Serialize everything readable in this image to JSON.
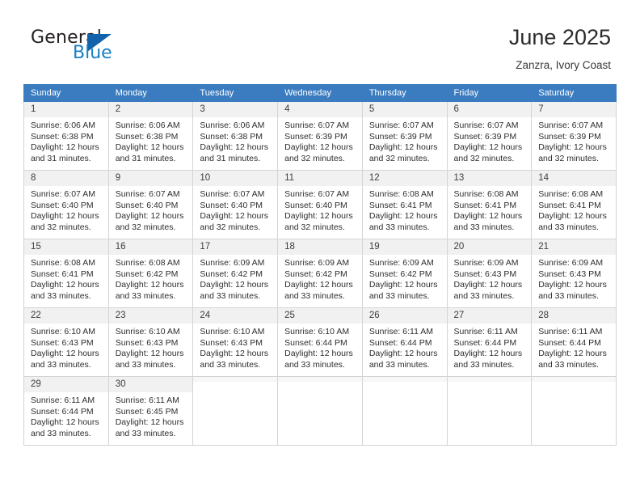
{
  "brand": {
    "name_top": "General",
    "name_bottom": "Blue",
    "accent_color": "#1161ab",
    "blue_text_color": "#1b7fc4",
    "triangle_icon": "triangle-icon"
  },
  "header": {
    "title": "June 2025",
    "subtitle": "Zanzra, Ivory Coast"
  },
  "calendar": {
    "header_color": "#3b7cc0",
    "weekday_headers": [
      "Sunday",
      "Monday",
      "Tuesday",
      "Wednesday",
      "Thursday",
      "Friday",
      "Saturday"
    ],
    "weeks": [
      [
        {
          "day": "1",
          "sunrise": "Sunrise: 6:06 AM",
          "sunset": "Sunset: 6:38 PM",
          "daylight_line1": "Daylight: 12 hours",
          "daylight_line2": "and 31 minutes."
        },
        {
          "day": "2",
          "sunrise": "Sunrise: 6:06 AM",
          "sunset": "Sunset: 6:38 PM",
          "daylight_line1": "Daylight: 12 hours",
          "daylight_line2": "and 31 minutes."
        },
        {
          "day": "3",
          "sunrise": "Sunrise: 6:06 AM",
          "sunset": "Sunset: 6:38 PM",
          "daylight_line1": "Daylight: 12 hours",
          "daylight_line2": "and 31 minutes."
        },
        {
          "day": "4",
          "sunrise": "Sunrise: 6:07 AM",
          "sunset": "Sunset: 6:39 PM",
          "daylight_line1": "Daylight: 12 hours",
          "daylight_line2": "and 32 minutes."
        },
        {
          "day": "5",
          "sunrise": "Sunrise: 6:07 AM",
          "sunset": "Sunset: 6:39 PM",
          "daylight_line1": "Daylight: 12 hours",
          "daylight_line2": "and 32 minutes."
        },
        {
          "day": "6",
          "sunrise": "Sunrise: 6:07 AM",
          "sunset": "Sunset: 6:39 PM",
          "daylight_line1": "Daylight: 12 hours",
          "daylight_line2": "and 32 minutes."
        },
        {
          "day": "7",
          "sunrise": "Sunrise: 6:07 AM",
          "sunset": "Sunset: 6:39 PM",
          "daylight_line1": "Daylight: 12 hours",
          "daylight_line2": "and 32 minutes."
        }
      ],
      [
        {
          "day": "8",
          "sunrise": "Sunrise: 6:07 AM",
          "sunset": "Sunset: 6:40 PM",
          "daylight_line1": "Daylight: 12 hours",
          "daylight_line2": "and 32 minutes."
        },
        {
          "day": "9",
          "sunrise": "Sunrise: 6:07 AM",
          "sunset": "Sunset: 6:40 PM",
          "daylight_line1": "Daylight: 12 hours",
          "daylight_line2": "and 32 minutes."
        },
        {
          "day": "10",
          "sunrise": "Sunrise: 6:07 AM",
          "sunset": "Sunset: 6:40 PM",
          "daylight_line1": "Daylight: 12 hours",
          "daylight_line2": "and 32 minutes."
        },
        {
          "day": "11",
          "sunrise": "Sunrise: 6:07 AM",
          "sunset": "Sunset: 6:40 PM",
          "daylight_line1": "Daylight: 12 hours",
          "daylight_line2": "and 32 minutes."
        },
        {
          "day": "12",
          "sunrise": "Sunrise: 6:08 AM",
          "sunset": "Sunset: 6:41 PM",
          "daylight_line1": "Daylight: 12 hours",
          "daylight_line2": "and 33 minutes."
        },
        {
          "day": "13",
          "sunrise": "Sunrise: 6:08 AM",
          "sunset": "Sunset: 6:41 PM",
          "daylight_line1": "Daylight: 12 hours",
          "daylight_line2": "and 33 minutes."
        },
        {
          "day": "14",
          "sunrise": "Sunrise: 6:08 AM",
          "sunset": "Sunset: 6:41 PM",
          "daylight_line1": "Daylight: 12 hours",
          "daylight_line2": "and 33 minutes."
        }
      ],
      [
        {
          "day": "15",
          "sunrise": "Sunrise: 6:08 AM",
          "sunset": "Sunset: 6:41 PM",
          "daylight_line1": "Daylight: 12 hours",
          "daylight_line2": "and 33 minutes."
        },
        {
          "day": "16",
          "sunrise": "Sunrise: 6:08 AM",
          "sunset": "Sunset: 6:42 PM",
          "daylight_line1": "Daylight: 12 hours",
          "daylight_line2": "and 33 minutes."
        },
        {
          "day": "17",
          "sunrise": "Sunrise: 6:09 AM",
          "sunset": "Sunset: 6:42 PM",
          "daylight_line1": "Daylight: 12 hours",
          "daylight_line2": "and 33 minutes."
        },
        {
          "day": "18",
          "sunrise": "Sunrise: 6:09 AM",
          "sunset": "Sunset: 6:42 PM",
          "daylight_line1": "Daylight: 12 hours",
          "daylight_line2": "and 33 minutes."
        },
        {
          "day": "19",
          "sunrise": "Sunrise: 6:09 AM",
          "sunset": "Sunset: 6:42 PM",
          "daylight_line1": "Daylight: 12 hours",
          "daylight_line2": "and 33 minutes."
        },
        {
          "day": "20",
          "sunrise": "Sunrise: 6:09 AM",
          "sunset": "Sunset: 6:43 PM",
          "daylight_line1": "Daylight: 12 hours",
          "daylight_line2": "and 33 minutes."
        },
        {
          "day": "21",
          "sunrise": "Sunrise: 6:09 AM",
          "sunset": "Sunset: 6:43 PM",
          "daylight_line1": "Daylight: 12 hours",
          "daylight_line2": "and 33 minutes."
        }
      ],
      [
        {
          "day": "22",
          "sunrise": "Sunrise: 6:10 AM",
          "sunset": "Sunset: 6:43 PM",
          "daylight_line1": "Daylight: 12 hours",
          "daylight_line2": "and 33 minutes."
        },
        {
          "day": "23",
          "sunrise": "Sunrise: 6:10 AM",
          "sunset": "Sunset: 6:43 PM",
          "daylight_line1": "Daylight: 12 hours",
          "daylight_line2": "and 33 minutes."
        },
        {
          "day": "24",
          "sunrise": "Sunrise: 6:10 AM",
          "sunset": "Sunset: 6:43 PM",
          "daylight_line1": "Daylight: 12 hours",
          "daylight_line2": "and 33 minutes."
        },
        {
          "day": "25",
          "sunrise": "Sunrise: 6:10 AM",
          "sunset": "Sunset: 6:44 PM",
          "daylight_line1": "Daylight: 12 hours",
          "daylight_line2": "and 33 minutes."
        },
        {
          "day": "26",
          "sunrise": "Sunrise: 6:11 AM",
          "sunset": "Sunset: 6:44 PM",
          "daylight_line1": "Daylight: 12 hours",
          "daylight_line2": "and 33 minutes."
        },
        {
          "day": "27",
          "sunrise": "Sunrise: 6:11 AM",
          "sunset": "Sunset: 6:44 PM",
          "daylight_line1": "Daylight: 12 hours",
          "daylight_line2": "and 33 minutes."
        },
        {
          "day": "28",
          "sunrise": "Sunrise: 6:11 AM",
          "sunset": "Sunset: 6:44 PM",
          "daylight_line1": "Daylight: 12 hours",
          "daylight_line2": "and 33 minutes."
        }
      ],
      [
        {
          "day": "29",
          "sunrise": "Sunrise: 6:11 AM",
          "sunset": "Sunset: 6:44 PM",
          "daylight_line1": "Daylight: 12 hours",
          "daylight_line2": "and 33 minutes."
        },
        {
          "day": "30",
          "sunrise": "Sunrise: 6:11 AM",
          "sunset": "Sunset: 6:45 PM",
          "daylight_line1": "Daylight: 12 hours",
          "daylight_line2": "and 33 minutes."
        },
        {
          "day": "",
          "sunrise": "",
          "sunset": "",
          "daylight_line1": "",
          "daylight_line2": ""
        },
        {
          "day": "",
          "sunrise": "",
          "sunset": "",
          "daylight_line1": "",
          "daylight_line2": ""
        },
        {
          "day": "",
          "sunrise": "",
          "sunset": "",
          "daylight_line1": "",
          "daylight_line2": ""
        },
        {
          "day": "",
          "sunrise": "",
          "sunset": "",
          "daylight_line1": "",
          "daylight_line2": ""
        },
        {
          "day": "",
          "sunrise": "",
          "sunset": "",
          "daylight_line1": "",
          "daylight_line2": ""
        }
      ]
    ]
  }
}
